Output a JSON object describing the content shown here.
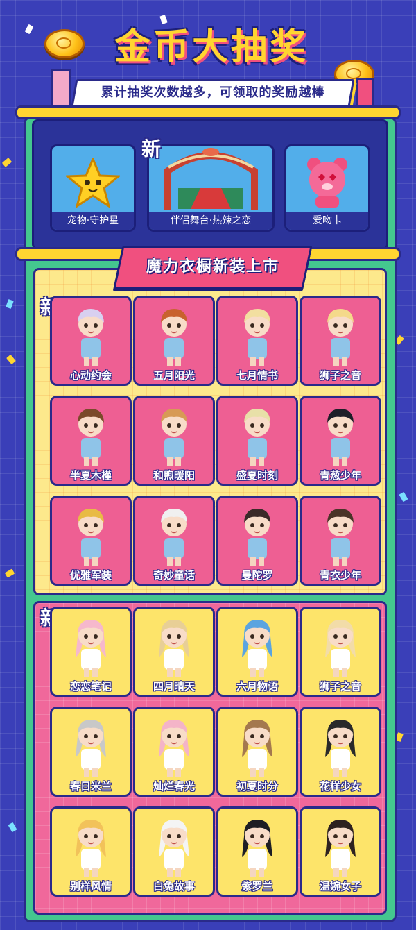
{
  "header": {
    "title": "金币大抽奖",
    "subtitle": "累计抽奖次数越多，可领取的奖励越棒"
  },
  "new_label": "新",
  "rewards": [
    {
      "label": "宠物·守护星",
      "icon": "star-pet-icon"
    },
    {
      "label": "伴侣舞台·热辣之恋",
      "icon": "stage-icon"
    },
    {
      "label": "爱吻卡",
      "icon": "bear-card-icon"
    }
  ],
  "banner": "魔力衣橱新装上市",
  "male_outfits": [
    {
      "label": "心动约会",
      "hair": "#d8d0f0"
    },
    {
      "label": "五月阳光",
      "hair": "#c8622e"
    },
    {
      "label": "七月情书",
      "hair": "#f2dfa0"
    },
    {
      "label": "狮子之音",
      "hair": "#f4d98a"
    },
    {
      "label": "半夏木槿",
      "hair": "#7a4a2a"
    },
    {
      "label": "和煦暖阳",
      "hair": "#d79a55"
    },
    {
      "label": "盛夏时刻",
      "hair": "#e8e0a8"
    },
    {
      "label": "青葱少年",
      "hair": "#1e1e28"
    },
    {
      "label": "优雅军装",
      "hair": "#e8bb45"
    },
    {
      "label": "奇妙童话",
      "hair": "#f0f0f0"
    },
    {
      "label": "曼陀罗",
      "hair": "#3a2a28"
    },
    {
      "label": "青衣少年",
      "hair": "#4a3428"
    }
  ],
  "female_outfits": [
    {
      "label": "恋恋笔记",
      "hair": "#f6b8cc"
    },
    {
      "label": "四月晴天",
      "hair": "#e8cf96"
    },
    {
      "label": "六月物语",
      "hair": "#5aa4e0"
    },
    {
      "label": "狮子之音",
      "hair": "#f2dca8"
    },
    {
      "label": "春日米兰",
      "hair": "#c8c8c8"
    },
    {
      "label": "灿烂春光",
      "hair": "#f4b4c8"
    },
    {
      "label": "初夏时分",
      "hair": "#a4784e"
    },
    {
      "label": "花样少女",
      "hair": "#2a2a2a"
    },
    {
      "label": "别样风情",
      "hair": "#f2c25a"
    },
    {
      "label": "白兔故事",
      "hair": "#f4f4f4"
    },
    {
      "label": "紫罗兰",
      "hair": "#1e1e24"
    },
    {
      "label": "温婉女子",
      "hair": "#2e2220"
    }
  ]
}
